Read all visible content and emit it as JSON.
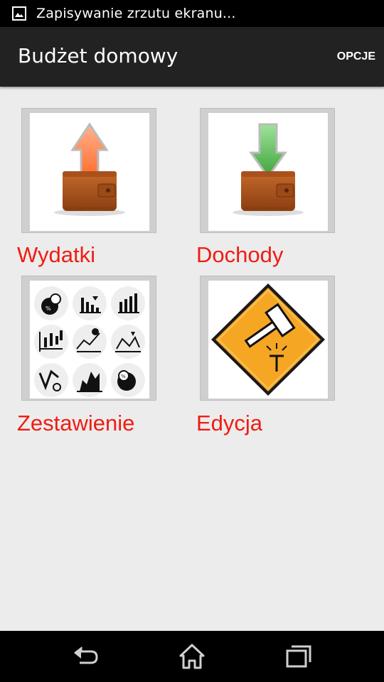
{
  "status_bar": {
    "notification_icon": "image-icon",
    "text": "Zapisywanie zrzutu ekranu..."
  },
  "action_bar": {
    "title": "Budżet domowy",
    "menu_label": "OPCJE"
  },
  "tiles": [
    {
      "label": "Wydatki",
      "icon": "wallet-arrow-up-icon"
    },
    {
      "label": "Dochody",
      "icon": "wallet-arrow-down-icon"
    },
    {
      "label": "Zestawienie",
      "icon": "charts-icon"
    },
    {
      "label": "Edycja",
      "icon": "hammer-sign-icon"
    }
  ],
  "nav_bar": {
    "icons": [
      "back-icon",
      "home-icon",
      "recent-apps-icon"
    ]
  },
  "colors": {
    "label_red": "#f01c12",
    "action_bar": "#222222",
    "background": "#ececec"
  }
}
